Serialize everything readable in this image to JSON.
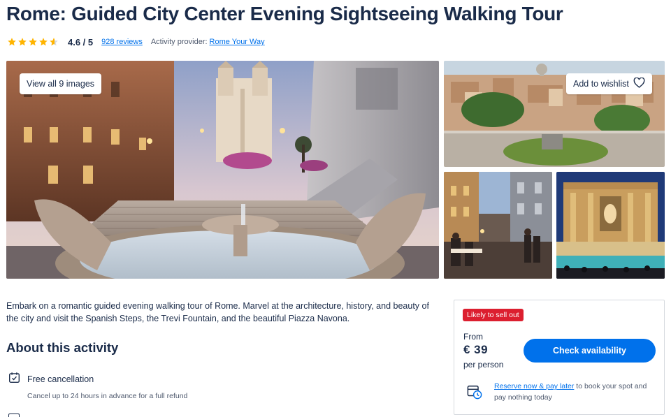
{
  "page": {
    "title": "Rome: Guided City Center Evening Sightseeing Walking Tour"
  },
  "rating": {
    "value": 4.6,
    "label": "4.6 / 5",
    "stars_max": 5,
    "star_color": "#ffb400",
    "reviews_link": "928 reviews",
    "provider_label": "Activity provider:",
    "provider_name": "Rome Your Way"
  },
  "gallery": {
    "view_all_label": "View all 9 images",
    "wishlist_label": "Add to wishlist",
    "images": [
      {
        "name": "spanish-steps-main-image"
      },
      {
        "name": "rome-rooftops-terrace-image"
      },
      {
        "name": "night-street-dining-image"
      },
      {
        "name": "trevi-fountain-night-image"
      }
    ]
  },
  "description": "Embark on a romantic guided evening walking tour of Rome. Marvel at the architecture, history, and beauty of the city and visit the Spanish Steps, the Trevi Fountain, and the beautiful Piazza Navona.",
  "about": {
    "title": "About this activity",
    "features": [
      {
        "icon": "calendar-check-icon",
        "title": "Free cancellation",
        "subtitle": "Cancel up to 24 hours in advance for a full refund"
      }
    ]
  },
  "booking": {
    "badge": "Likely to sell out",
    "badge_color": "#dc1f2f",
    "from_label": "From",
    "price": "€ 39",
    "per_label": "per person",
    "cta_label": "Check availability",
    "cta_color": "#0071eb",
    "reserve_link": "Reserve now & pay later",
    "reserve_text": " to book your spot and pay nothing today"
  }
}
